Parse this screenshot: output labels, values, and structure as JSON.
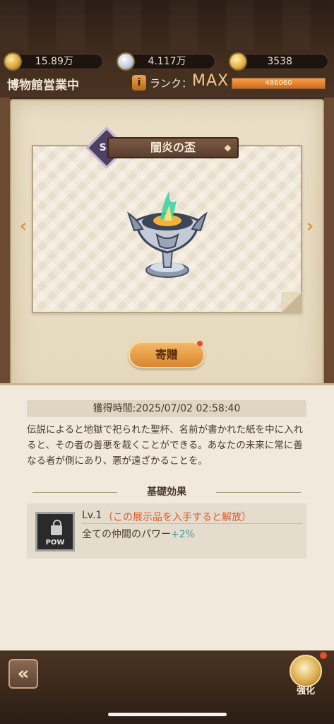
{
  "header": {
    "currencies": [
      {
        "icon": "gold-coin-icon",
        "value": "15.89万"
      },
      {
        "icon": "silver-coin-icon",
        "value": "4.117万"
      },
      {
        "icon": "medal-coin-icon",
        "value": "3538"
      }
    ],
    "museum_status": "博物館営業中",
    "rank_icon": "i",
    "rank_label": "ランク：",
    "rank_value": "MAX",
    "rank_progress_text": "486060",
    "rank_progress_fraction": 1.0
  },
  "item": {
    "rarity": "SR",
    "name": "闇炎の盃",
    "icon": "dark-flame-goblet-icon"
  },
  "nav": {
    "prev_icon": "chevron-left-icon",
    "next_icon": "chevron-right-icon",
    "prev_glyph": "‹",
    "next_glyph": "›"
  },
  "actions": {
    "donate_label": "寄贈"
  },
  "details": {
    "acquired_label": "獲得時間:2025/07/02 02:58:40",
    "description": "伝説によると地獄で祀られた聖杯、名前が書かれた紙を中に入れると、その者の善悪を裁くことができる。あなたの未来に常に善なる者が側にあり、悪が遠ざかることを。",
    "section_title": "基礎効果",
    "effect": {
      "icon_label": "POW",
      "level": "Lv.1",
      "condition": "（この展示品を入手すると解放）",
      "description": "全ての仲間のパワー",
      "bonus": "+2%"
    }
  },
  "footer": {
    "back_glyph": "«",
    "enhance_label": "強化"
  },
  "colors": {
    "accent_orange": "#d9852e",
    "parchment": "#eadfc7",
    "wood": "#3d2a1d",
    "condition_red": "#e05a2a",
    "bonus_teal": "#4a9a9a"
  }
}
